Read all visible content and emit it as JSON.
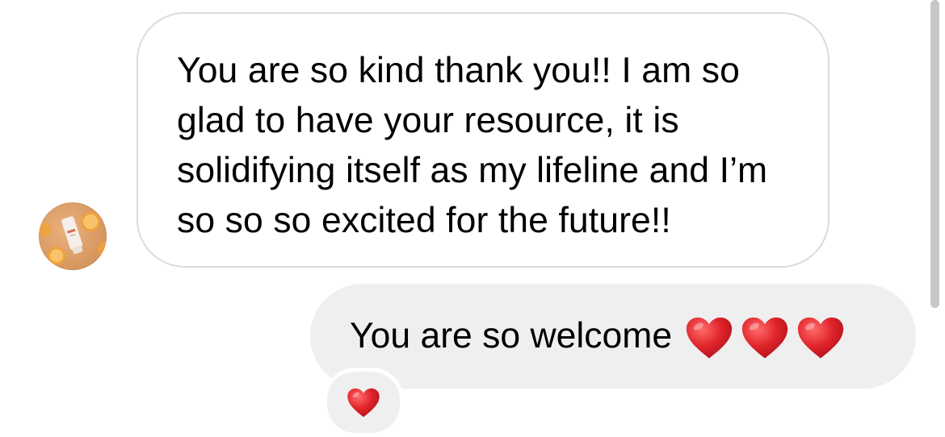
{
  "conversation": {
    "incoming": {
      "sender_avatar": "avatar-image",
      "text": "You are so kind thank you!! I am so glad to have your resource, it is solidifying itself as my lifeline and I’m so so so excited for the future!!"
    },
    "outgoing": {
      "text": "You are so welcome",
      "emojis": [
        "heart-icon",
        "heart-icon",
        "heart-icon"
      ]
    },
    "reaction": {
      "emoji": "heart-icon"
    }
  },
  "colors": {
    "incoming_bubble_border": "#dbdbdb",
    "outgoing_bubble_bg": "#efefef",
    "heart_red": "#e0242b",
    "scrollbar": "#c7c7c7",
    "avatar_bg": "#d99a62"
  }
}
